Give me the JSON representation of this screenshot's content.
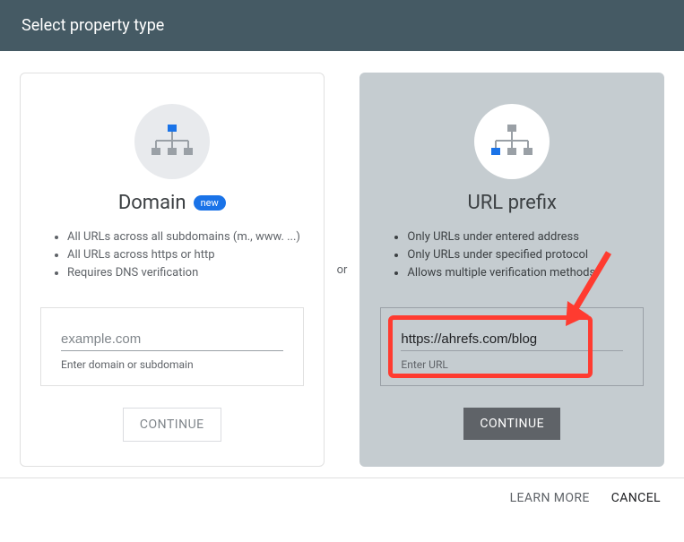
{
  "header": {
    "title": "Select property type"
  },
  "or_label": "or",
  "domain_card": {
    "title": "Domain",
    "badge": "new",
    "bullets": [
      "All URLs across all subdomains (m., www. ...)",
      "All URLs across https or http",
      "Requires DNS verification"
    ],
    "input_placeholder": "example.com",
    "input_hint": "Enter domain or subdomain",
    "button": "CONTINUE"
  },
  "urlprefix_card": {
    "title": "URL prefix",
    "bullets": [
      "Only URLs under entered address",
      "Only URLs under specified protocol",
      "Allows multiple verification methods"
    ],
    "input_value": "https://ahrefs.com/blog",
    "input_hint": "Enter URL",
    "button": "CONTINUE"
  },
  "footer": {
    "learn_more": "LEARN MORE",
    "cancel": "CANCEL"
  },
  "annotation": {
    "highlight_color": "#ff3b30"
  }
}
